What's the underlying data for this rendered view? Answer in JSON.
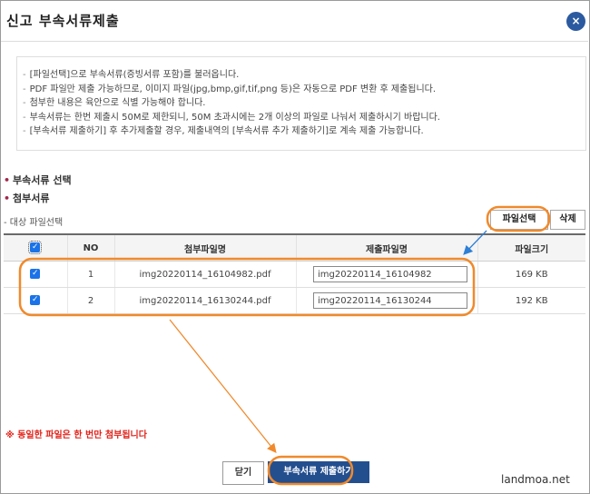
{
  "dialog": {
    "title": "신고 부속서류제출",
    "close_icon": "×"
  },
  "notice": {
    "lines": [
      "[파일선택]으로 부속서류(증빙서류 포함)를 불러옵니다.",
      "PDF 파일만 제출 가능하므로, 이미지 파일(jpg,bmp,gif,tif,png 등)은 자동으로 PDF 변환 후 제출됩니다.",
      "첨부한 내용은 육안으로 식별 가능해야 합니다.",
      "부속서류는 한번 제출시 50M로 제한되니, 50M 초과시에는 2개 이상의 파일로 나눠서 제출하시기 바랍니다.",
      "[부속서류 제출하기] 후 추가제출할 경우, 제출내역의 [부속서류 추가 제출하기]로 계속 제출 가능합니다."
    ]
  },
  "sections": {
    "select_label": "부속서류 선택",
    "attached_label": "첨부서류",
    "target_label": "- 대상 파일선택"
  },
  "toolbar": {
    "file_select": "파일선택",
    "delete": "삭제"
  },
  "table": {
    "headers": {
      "no": "NO",
      "attached_name": "첨부파일명",
      "submit_name": "제출파일명",
      "size": "파일크기"
    },
    "rows": [
      {
        "no": "1",
        "attached_name": "img20220114_16104982.pdf",
        "submit_name": "img20220114_16104982",
        "size": "169 KB",
        "checked": true
      },
      {
        "no": "2",
        "attached_name": "img20220114_16130244.pdf",
        "submit_name": "img20220114_16130244",
        "size": "192 KB",
        "checked": true
      }
    ]
  },
  "warning": "※ 동일한 파일은 한 번만 첨부됩니다",
  "buttons": {
    "close": "닫기",
    "submit": "부속서류 제출하기"
  },
  "watermark": "landmoa.net",
  "colors": {
    "accent_blue": "#244f8f",
    "annotation_orange": "#f08a2c",
    "warning_red": "#e2231a"
  }
}
